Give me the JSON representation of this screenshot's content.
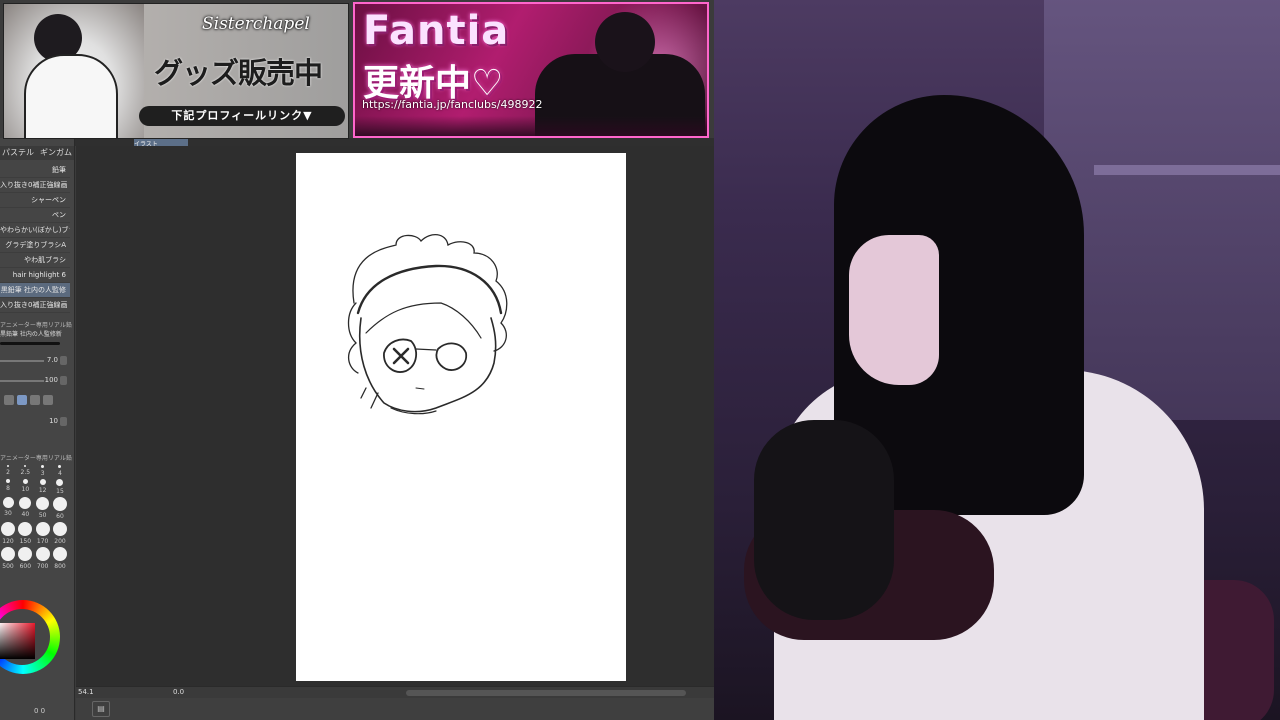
{
  "banner_left": {
    "brand": "Sisterchapel",
    "headline": "グッズ販売中",
    "link_label": "下記プロフィールリンク▼"
  },
  "banner_right": {
    "title": "Fantia",
    "subtitle": "更新中♡",
    "url": "https://fantia.jp/fanclubs/498922"
  },
  "app": {
    "tabs": [
      "パステル",
      "ギンガム"
    ],
    "doc_tab": "イラスト",
    "brushes": [
      {
        "label": "鉛筆",
        "selected": false
      },
      {
        "label": "入り抜き0補正強線画",
        "selected": false
      },
      {
        "label": "シャーペン",
        "selected": false
      },
      {
        "label": "ペン",
        "selected": false
      },
      {
        "label": "やわらかい(ぼかし)ブラシ",
        "selected": false
      },
      {
        "label": "グラデ塗りブラシA",
        "selected": false
      },
      {
        "label": "やわ肌ブラシ",
        "selected": false
      },
      {
        "label": "hair highlight 6",
        "selected": false
      },
      {
        "label": "黒鉛筆 社内の人監修",
        "selected": true
      },
      {
        "label": "入り抜き0補正強線画",
        "selected": false
      }
    ],
    "brush_preset_title": "アニメーター専用リアル鉛筆",
    "brush_preset_sub": "黒鉛筆 社内の人監修新",
    "props": [
      {
        "label": "size",
        "value": "7.0"
      },
      {
        "label": "opacity",
        "value": "100"
      },
      {
        "label": "smooth",
        "value": "10"
      }
    ],
    "size_panel_title": "アニメーター専用リアル鉛筆 社内",
    "sizes": [
      [
        "2",
        "2.5",
        "3",
        "4"
      ],
      [
        "8",
        "10",
        "12",
        "15"
      ],
      [
        "30",
        "40",
        "50",
        "60"
      ],
      [
        "120",
        "150",
        "170",
        "200"
      ],
      [
        "500",
        "600",
        "700",
        "800"
      ]
    ],
    "status": {
      "zoom": "54.1",
      "rotation": "0.0"
    },
    "bottom_left": "0 0",
    "accent_color": "#e8192c"
  }
}
